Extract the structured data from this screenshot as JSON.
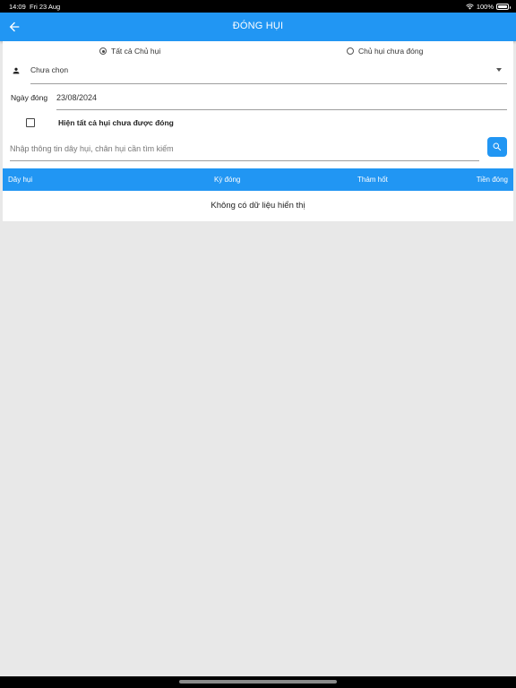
{
  "status_bar": {
    "time": "14:09",
    "date": "Fri 23 Aug",
    "battery": "100%"
  },
  "app_bar": {
    "title": "ĐÓNG HỤI",
    "back_icon": "arrow-left-icon"
  },
  "filter": {
    "radio_all": "Tất cả Chủ hụi",
    "radio_unpaid": "Chủ hụi chưa đóng",
    "selected": "all"
  },
  "owner_select": {
    "value": "Chưa chọn",
    "icon": "person-icon"
  },
  "date_field": {
    "label": "Ngày đóng",
    "value": "23/08/2024"
  },
  "show_all_checkbox": {
    "label": "Hiện tất cả hụi chưa được đóng",
    "checked": false
  },
  "search": {
    "placeholder": "Nhập thông tin dây hụi, chân hụi cần tìm kiếm",
    "value": ""
  },
  "table": {
    "columns": [
      "Dây hụi",
      "Kỳ đóng",
      "Thảm hốt",
      "Tiền đóng"
    ],
    "empty_message": "Không có dữ liệu hiển thị"
  },
  "colors": {
    "primary": "#2196f3",
    "background": "#e8e8e8"
  }
}
